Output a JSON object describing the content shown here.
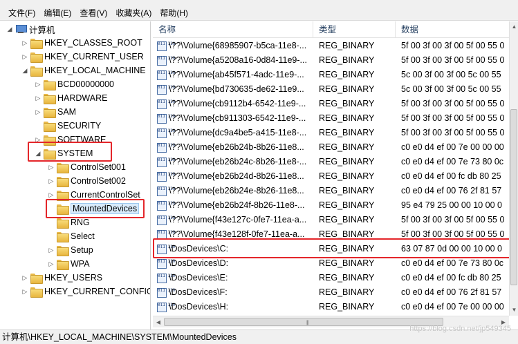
{
  "menu": [
    "文件(F)",
    "编辑(E)",
    "查看(V)",
    "收藏夹(A)",
    "帮助(H)"
  ],
  "tree": {
    "root": "计算机",
    "nodes": [
      {
        "label": "HKEY_CLASSES_ROOT",
        "arrow": "▷"
      },
      {
        "label": "HKEY_CURRENT_USER",
        "arrow": "▷"
      },
      {
        "label": "HKEY_LOCAL_MACHINE",
        "arrow": "◢"
      },
      {
        "label": "BCD00000000",
        "arrow": "▷"
      },
      {
        "label": "HARDWARE",
        "arrow": "▷"
      },
      {
        "label": "SAM",
        "arrow": "▷"
      },
      {
        "label": "SECURITY",
        "arrow": ""
      },
      {
        "label": "SOFTWARE",
        "arrow": "▷"
      },
      {
        "label": "SYSTEM",
        "arrow": "◢"
      },
      {
        "label": "ControlSet001",
        "arrow": "▷"
      },
      {
        "label": "ControlSet002",
        "arrow": "▷"
      },
      {
        "label": "CurrentControlSet",
        "arrow": "▷"
      },
      {
        "label": "MountedDevices",
        "arrow": ""
      },
      {
        "label": "RNG",
        "arrow": ""
      },
      {
        "label": "Select",
        "arrow": ""
      },
      {
        "label": "Setup",
        "arrow": "▷"
      },
      {
        "label": "WPA",
        "arrow": "▷"
      },
      {
        "label": "HKEY_USERS",
        "arrow": "▷"
      },
      {
        "label": "HKEY_CURRENT_CONFIG",
        "arrow": "▷"
      }
    ]
  },
  "columns": {
    "name": "名称",
    "type": "类型",
    "data": "数据"
  },
  "rows": [
    {
      "name": "\\??\\Volume{68985907-b5ca-11e8-...",
      "type": "REG_BINARY",
      "data": "5f 00 3f 00 3f 00 5f 00 55 0"
    },
    {
      "name": "\\??\\Volume{a5208a16-0d84-11e9-...",
      "type": "REG_BINARY",
      "data": "5f 00 3f 00 3f 00 5f 00 55 0"
    },
    {
      "name": "\\??\\Volume{ab45f571-4adc-11e9-...",
      "type": "REG_BINARY",
      "data": "5c 00 3f 00 3f 00 5c 00 55"
    },
    {
      "name": "\\??\\Volume{bd730635-de62-11e9...",
      "type": "REG_BINARY",
      "data": "5c 00 3f 00 3f 00 5c 00 55"
    },
    {
      "name": "\\??\\Volume{cb9112b4-6542-11e9-...",
      "type": "REG_BINARY",
      "data": "5f 00 3f 00 3f 00 5f 00 55 0"
    },
    {
      "name": "\\??\\Volume{cb911303-6542-11e9-...",
      "type": "REG_BINARY",
      "data": "5f 00 3f 00 3f 00 5f 00 55 0"
    },
    {
      "name": "\\??\\Volume{dc9a4be5-a415-11e8-...",
      "type": "REG_BINARY",
      "data": "5f 00 3f 00 3f 00 5f 00 55 0"
    },
    {
      "name": "\\??\\Volume{eb26b24b-8b26-11e8...",
      "type": "REG_BINARY",
      "data": "c0 e0 d4 ef 00 7e 00 00 00"
    },
    {
      "name": "\\??\\Volume{eb26b24c-8b26-11e8-...",
      "type": "REG_BINARY",
      "data": "c0 e0 d4 ef 00 7e 73 80 0c"
    },
    {
      "name": "\\??\\Volume{eb26b24d-8b26-11e8...",
      "type": "REG_BINARY",
      "data": "c0 e0 d4 ef 00 fc db 80 25"
    },
    {
      "name": "\\??\\Volume{eb26b24e-8b26-11e8...",
      "type": "REG_BINARY",
      "data": "c0 e0 d4 ef 00 76 2f 81 57"
    },
    {
      "name": "\\??\\Volume{eb26b24f-8b26-11e8-...",
      "type": "REG_BINARY",
      "data": "95 e4 79 25 00 00 10 00 0"
    },
    {
      "name": "\\??\\Volume{f43e127c-0fe7-11ea-a...",
      "type": "REG_BINARY",
      "data": "5f 00 3f 00 3f 00 5f 00 55 0"
    },
    {
      "name": "\\??\\Volume{f43e128f-0fe7-11ea-a...",
      "type": "REG_BINARY",
      "data": "5f 00 3f 00 3f 00 5f 00 55 0"
    },
    {
      "name": "\\DosDevices\\C:",
      "type": "REG_BINARY",
      "data": "63 07 87 0d 00 00 10 00 0"
    },
    {
      "name": "\\DosDevices\\D:",
      "type": "REG_BINARY",
      "data": "c0 e0 d4 ef 00 7e 73 80 0c"
    },
    {
      "name": "\\DosDevices\\E:",
      "type": "REG_BINARY",
      "data": "c0 e0 d4 ef 00 fc db 80 25"
    },
    {
      "name": "\\DosDevices\\F:",
      "type": "REG_BINARY",
      "data": "c0 e0 d4 ef 00 76 2f 81 57"
    },
    {
      "name": "\\DosDevices\\H:",
      "type": "REG_BINARY",
      "data": "c0 e0 d4 ef 00 7e 00 00 00"
    }
  ],
  "status_path": "计算机\\HKEY_LOCAL_MACHINE\\SYSTEM\\MountedDevices",
  "watermark": "https://blog.csdn.net/jp549345",
  "binary_icon_text": "011\n110",
  "colors": {
    "highlight": "#e4262a",
    "header_text": "#1e395b"
  }
}
